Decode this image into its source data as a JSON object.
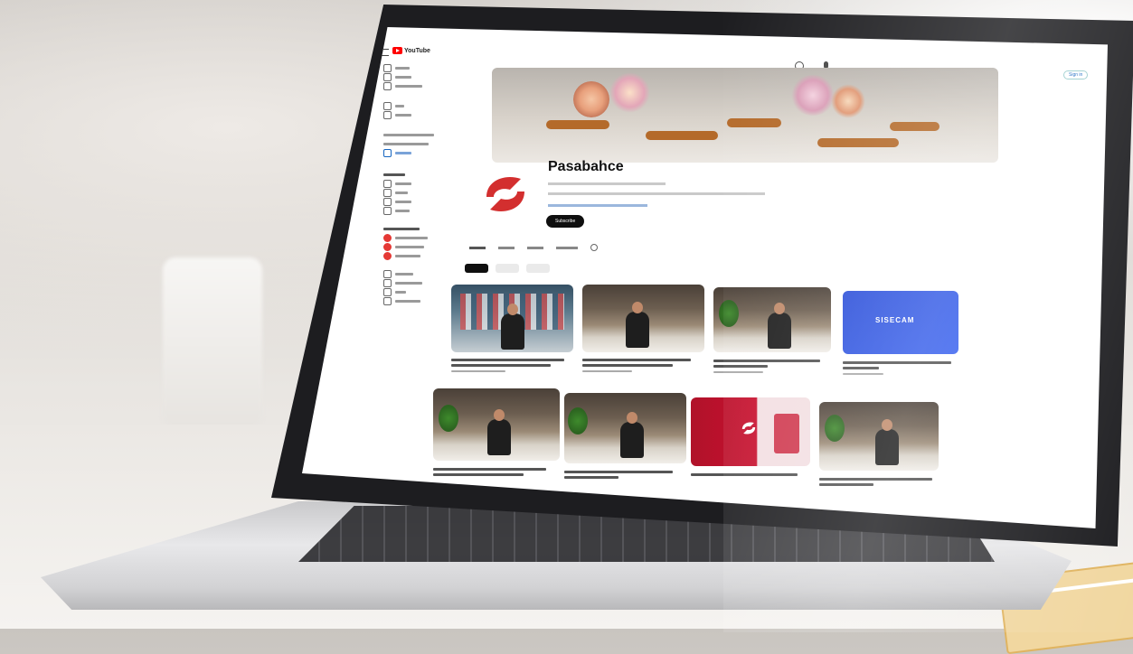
{
  "youtube": {
    "logo_text": "YouTube",
    "channel_name": "Pasabahce",
    "subscribe_label": "Subscribe",
    "sign_in_label": "Sign in"
  },
  "sidebar": {
    "items": [
      {
        "icon": "home-icon"
      },
      {
        "icon": "shorts-icon"
      },
      {
        "icon": "subscriptions-icon"
      },
      {
        "icon": "you-icon"
      },
      {
        "icon": "history-icon"
      },
      {
        "icon": "trending-icon"
      },
      {
        "icon": "music-icon"
      },
      {
        "icon": "gaming-icon"
      },
      {
        "icon": "sports-icon"
      },
      {
        "icon": "youtube-premium-icon"
      },
      {
        "icon": "youtube-music-icon"
      },
      {
        "icon": "youtube-kids-icon"
      },
      {
        "icon": "settings-icon"
      },
      {
        "icon": "report-icon"
      },
      {
        "icon": "help-icon"
      },
      {
        "icon": "feedback-icon"
      }
    ]
  },
  "channel_tabs": [
    {
      "id": "tab-1"
    },
    {
      "id": "tab-2"
    },
    {
      "id": "tab-3"
    },
    {
      "id": "tab-4"
    },
    {
      "id": "tab-5"
    }
  ],
  "filter_chips": [
    {
      "id": "chip-1",
      "active": true
    },
    {
      "id": "chip-2",
      "active": false
    },
    {
      "id": "chip-3",
      "active": false
    }
  ],
  "videos": [
    {
      "thumb": "store-shelves"
    },
    {
      "thumb": "chef-kitchen"
    },
    {
      "thumb": "chef-kitchen-plant"
    },
    {
      "thumb": "logo-card",
      "logo_text": "SISECAM",
      "accent": "#2c4fd8"
    },
    {
      "thumb": "chef-kitchen-plant"
    },
    {
      "thumb": "chef-kitchen-plant"
    },
    {
      "thumb": "red-brand-card",
      "accent": "#c8102e"
    },
    {
      "thumb": "chef-kitchen-plant"
    }
  ],
  "colors": {
    "youtube_red": "#ff0000",
    "brand_red": "#d32f2f",
    "subscribe_bg": "#0f0f0f"
  }
}
